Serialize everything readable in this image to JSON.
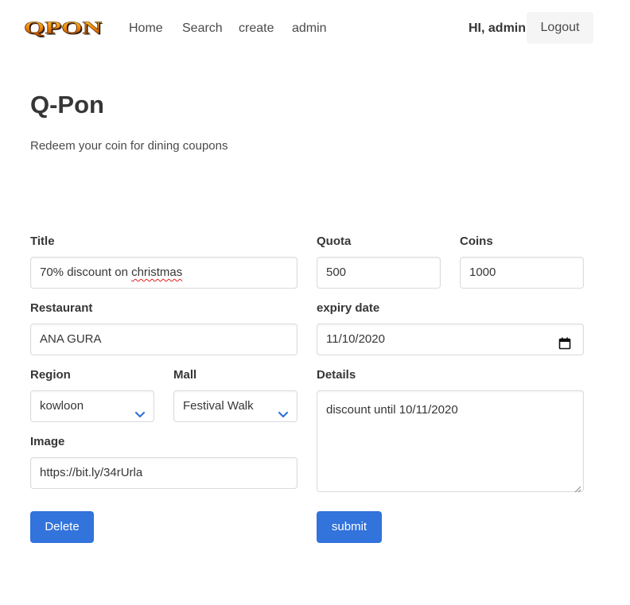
{
  "navbar": {
    "logo_text": "QPON",
    "links": [
      "Home",
      "Search",
      "create",
      "admin"
    ],
    "greeting": "HI, admin",
    "logout_label": "Logout"
  },
  "hero": {
    "title": "Q-Pon",
    "subtitle": "Redeem your coin for dining coupons"
  },
  "form": {
    "title_label": "Title",
    "title_value_prefix": "70% discount on ",
    "title_value_misspelled": "christmas",
    "restaurant_label": "Restaurant",
    "restaurant_value": "ANA GURA",
    "region_label": "Region",
    "region_value": "kowloon",
    "mall_label": "Mall",
    "mall_value": "Festival Walk",
    "image_label": "Image",
    "image_value": "https://bit.ly/34rUrla",
    "quota_label": "Quota",
    "quota_value": "500",
    "coins_label": "Coins",
    "coins_value": "1000",
    "expiry_label": "expiry date",
    "expiry_value": "11/10/2020",
    "details_label": "Details",
    "details_value": "discount until 10/11/2020",
    "delete_label": "Delete",
    "submit_label": "submit"
  },
  "colors": {
    "primary": "#3273dc",
    "text": "#363636",
    "border": "#dbdbdb",
    "logout_bg": "#f5f5f5"
  },
  "icons": [
    "qpon-logo",
    "chevron-down-icon",
    "calendar-icon",
    "resize-grip-icon"
  ]
}
